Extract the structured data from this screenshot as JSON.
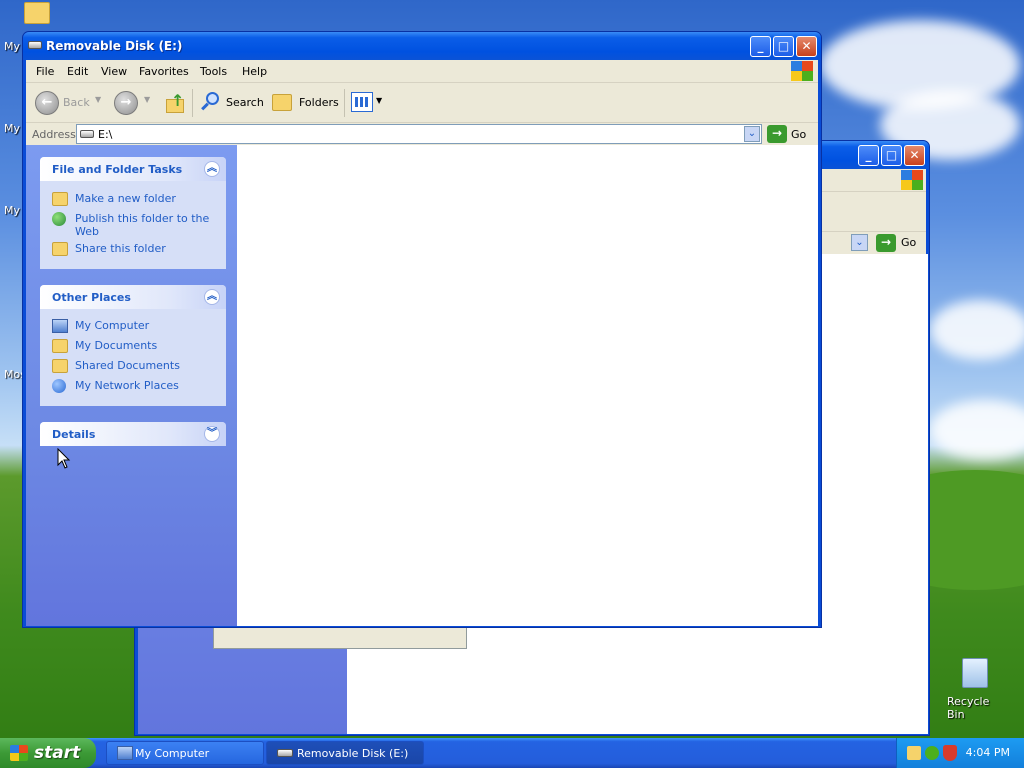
{
  "desktop": {
    "icons": [
      {
        "label": "My"
      },
      {
        "label": "My"
      },
      {
        "label": "My"
      },
      {
        "label": "Mos"
      },
      {
        "label": "Recycle Bin"
      }
    ]
  },
  "front_window": {
    "title": "Removable Disk (E:)",
    "menu": [
      "File",
      "Edit",
      "View",
      "Favorites",
      "Tools",
      "Help"
    ],
    "toolbar": {
      "back_label": "Back",
      "search_label": "Search",
      "folders_label": "Folders"
    },
    "address": {
      "label": "Address",
      "value": "E:\\",
      "go_label": "Go"
    },
    "panels": {
      "file_tasks": {
        "title": "File and Folder Tasks",
        "items": [
          "Make a new folder",
          "Publish this folder to the Web",
          "Share this folder"
        ]
      },
      "other_places": {
        "title": "Other Places",
        "items": [
          "My Computer",
          "My Documents",
          "Shared Documents",
          "My Network Places"
        ]
      },
      "details": {
        "title": "Details"
      }
    }
  },
  "back_window": {
    "go_label": "Go"
  },
  "taskbar": {
    "start_label": "start",
    "buttons": [
      {
        "label": "My Computer"
      },
      {
        "label": "Removable Disk (E:)"
      }
    ],
    "clock": "4:04 PM"
  },
  "colors": {
    "titlebar": "#0051e0",
    "link": "#215dc6",
    "taskbar": "#245ddb",
    "start": "#3c9a36"
  }
}
